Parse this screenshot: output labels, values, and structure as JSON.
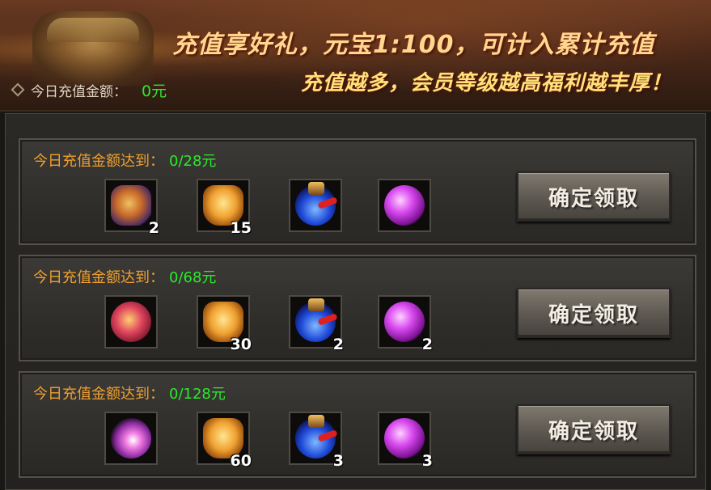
{
  "banner": {
    "line1": "充值享好礼，元宝1:100，可计入累计充值",
    "line2": "充值越多，会员等级越高福利越丰厚！",
    "today_label": "今日充值金额：",
    "today_value": "0元"
  },
  "tiers": [
    {
      "label": "今日充值金额达到：",
      "progress": "0/28元",
      "claim_label": "确定领取",
      "items": [
        {
          "icon": "armor-icon",
          "count": "2"
        },
        {
          "icon": "gold-crystal-icon",
          "count": "15"
        },
        {
          "icon": "blue-potion-icon",
          "count": ""
        },
        {
          "icon": "purple-orb-icon",
          "count": ""
        }
      ]
    },
    {
      "label": "今日充值金额达到：",
      "progress": "0/68元",
      "claim_label": "确定领取",
      "items": [
        {
          "icon": "red-gold-egg-icon",
          "count": ""
        },
        {
          "icon": "gold-crystal-icon",
          "count": "30"
        },
        {
          "icon": "blue-potion-icon",
          "count": "2"
        },
        {
          "icon": "purple-orb-icon",
          "count": "2"
        }
      ]
    },
    {
      "label": "今日充值金额达到：",
      "progress": "0/128元",
      "claim_label": "确定领取",
      "items": [
        {
          "icon": "pink-sparkle-icon",
          "count": ""
        },
        {
          "icon": "gold-crystal-icon",
          "count": "60"
        },
        {
          "icon": "blue-potion-icon",
          "count": "3"
        },
        {
          "icon": "purple-orb-icon",
          "count": "3"
        }
      ]
    }
  ]
}
